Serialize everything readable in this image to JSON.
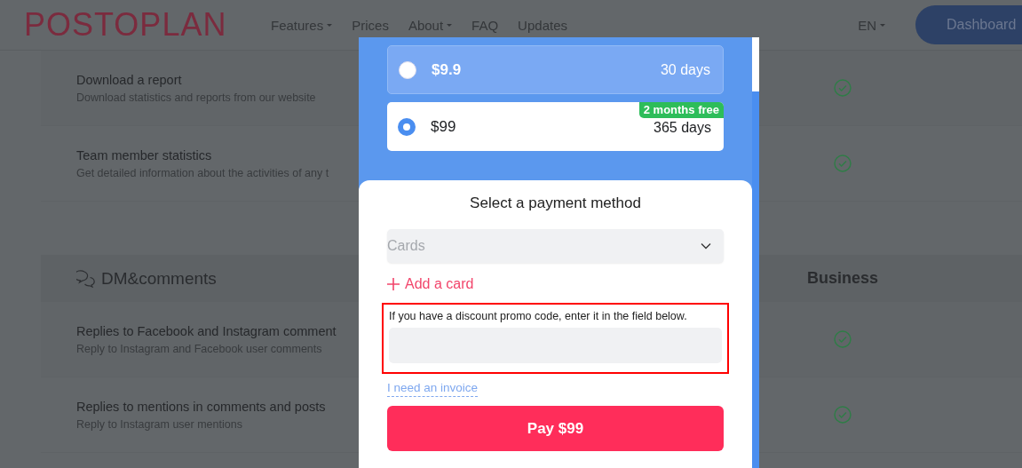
{
  "header": {
    "logo": "POSTOPLAN",
    "nav": [
      {
        "label": "Features",
        "dropdown": true
      },
      {
        "label": "Prices",
        "dropdown": false
      },
      {
        "label": "About",
        "dropdown": true
      },
      {
        "label": "FAQ",
        "dropdown": false
      },
      {
        "label": "Updates",
        "dropdown": false
      }
    ],
    "language": "EN",
    "dashboard_button": "Dashboard"
  },
  "features": [
    {
      "kind": "row",
      "title": "Download a report",
      "description": "Download statistics and reports from our website",
      "included": true
    },
    {
      "kind": "row",
      "title": "Team member statistics",
      "description": "Get detailed information about the activities of any t",
      "included": true
    },
    {
      "kind": "section",
      "title": "DM&comments",
      "plan": "Business"
    },
    {
      "kind": "row",
      "title": "Replies to Facebook and Instagram comment",
      "description": "Reply to Instagram and Facebook user comments",
      "included": true
    },
    {
      "kind": "row",
      "title": "Replies to mentions in comments and posts",
      "description": "Reply to Instagram user mentions",
      "included": true
    }
  ],
  "modal": {
    "plans": [
      {
        "price": "$9.9",
        "period": "30 days",
        "selected": false
      },
      {
        "price": "$99",
        "period": "365 days",
        "badge": "2 months free",
        "selected": true
      }
    ],
    "payment": {
      "title": "Select a payment method",
      "method_select": {
        "placeholder": "Cards"
      },
      "add_card": "Add a card",
      "promo": {
        "label": "If you have a discount promo code, enter it in the field below.",
        "highlighted": true
      },
      "invoice_link": "I need an invoice",
      "pay_button": "Pay $99"
    }
  }
}
